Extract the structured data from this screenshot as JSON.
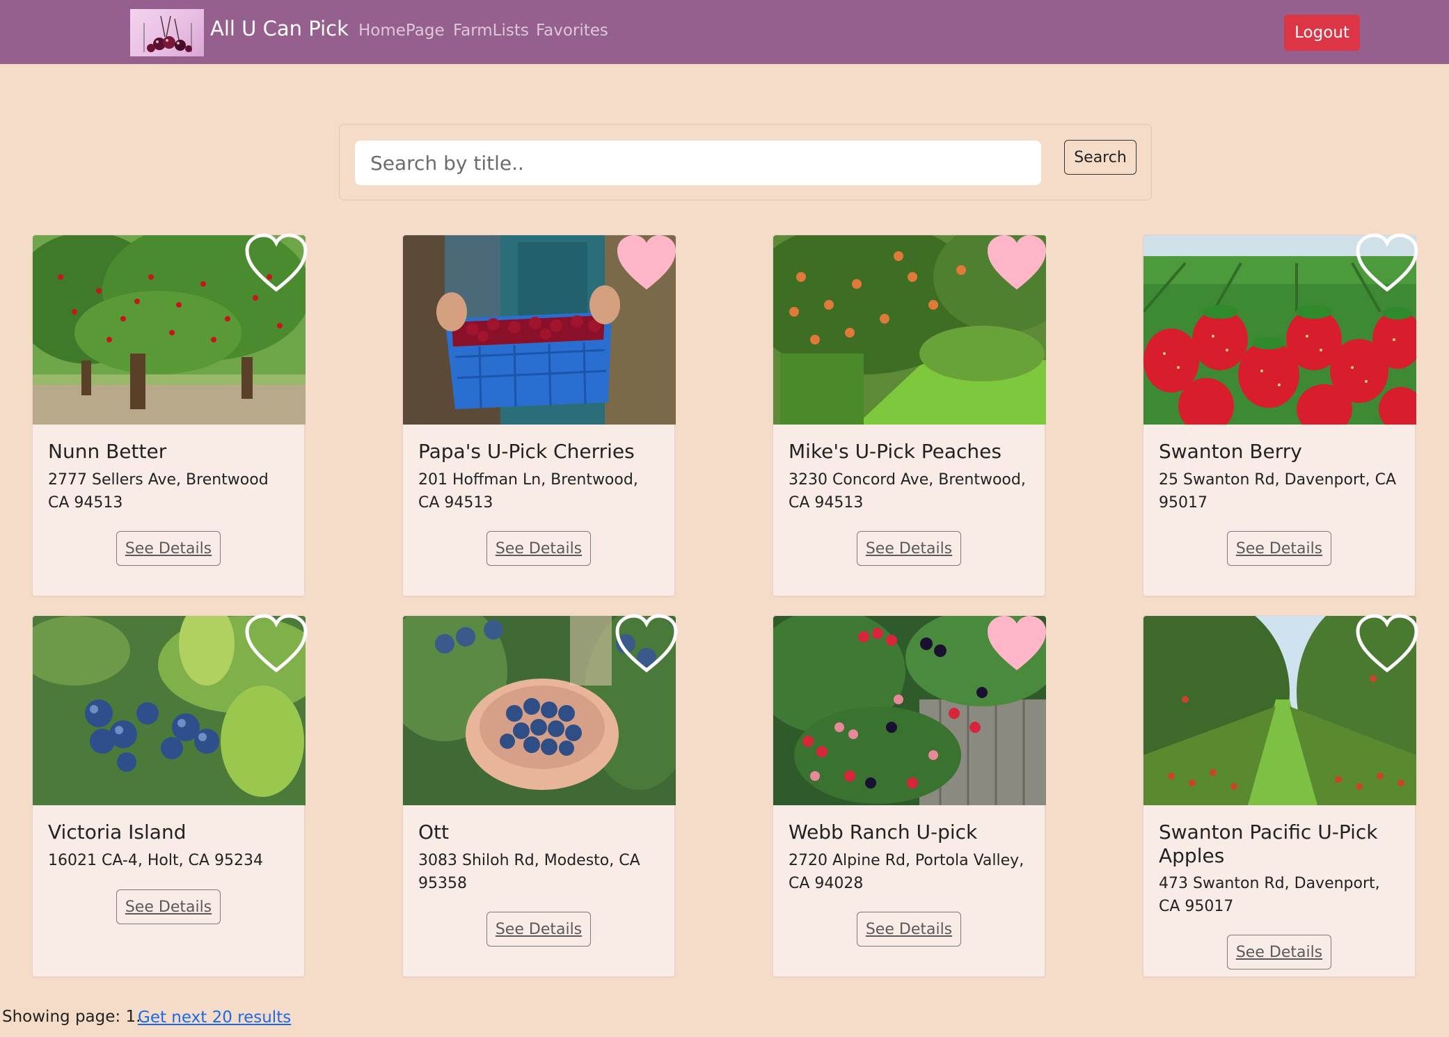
{
  "navbar": {
    "brand_name": "All U Can Pick",
    "links": [
      "HomePage",
      "FarmLists",
      "Favorites"
    ],
    "logout_label": "Logout"
  },
  "search": {
    "placeholder": "Search by title..",
    "button_label": "Search"
  },
  "farms": [
    {
      "title": "Nunn Better",
      "address": "2777 Sellers Ave, Brentwood CA 94513",
      "favorite": false,
      "image": "cherry-orchard"
    },
    {
      "title": "Papa's U-Pick Cherries",
      "address": "201 Hoffman Ln, Brentwood, CA 94513",
      "favorite": true,
      "image": "cherries-crate"
    },
    {
      "title": "Mike's U-Pick Peaches",
      "address": "3230 Concord Ave, Brentwood, CA 94513",
      "favorite": true,
      "image": "peach-orchard"
    },
    {
      "title": "Swanton Berry",
      "address": "25 Swanton Rd, Davenport, CA 95017",
      "favorite": false,
      "image": "strawberries"
    },
    {
      "title": "Victoria Island",
      "address": "16021 CA-4, Holt, CA 95234",
      "favorite": false,
      "image": "blueberry-bush"
    },
    {
      "title": "Ott",
      "address": "3083 Shiloh Rd, Modesto, CA 95358",
      "favorite": false,
      "image": "blueberries-hands"
    },
    {
      "title": "Webb Ranch U-pick",
      "address": "2720 Alpine Rd, Portola Valley, CA 94028",
      "favorite": true,
      "image": "blackberries"
    },
    {
      "title": "Swanton Pacific U-Pick Apples",
      "address": "473 Swanton Rd, Davenport, CA 95017",
      "favorite": false,
      "image": "apple-orchard"
    }
  ],
  "see_details_label": "See Details",
  "footer": {
    "paging_text": "Showing page: 1.",
    "next_link": "Get next 20 results"
  },
  "colors": {
    "navbar": "#95608d",
    "page_bg": "#f5dcc9",
    "card_bg": "#f9ece6",
    "logout": "#dc3545",
    "heart_favorite": "#ffb6c8",
    "link": "#1a6ae8"
  }
}
